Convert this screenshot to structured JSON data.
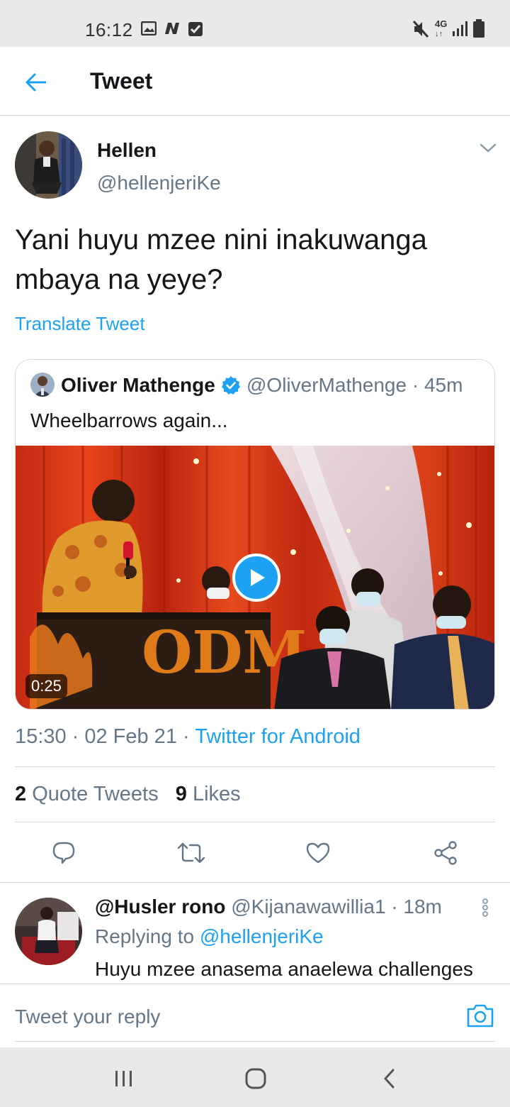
{
  "status_bar": {
    "time": "16:12",
    "network": "4G"
  },
  "header": {
    "title": "Tweet"
  },
  "tweet": {
    "author_name": "Hellen",
    "author_handle": "@hellenjeriKe",
    "text": "Yani huyu mzee nini inakuwanga mbaya na yeye?",
    "translate_label": "Translate Tweet",
    "timestamp": "15:30 · 02 Feb 21 · ",
    "source": "Twitter for Android",
    "quote_count": "2",
    "quote_label": " Quote Tweets",
    "like_count": "9",
    "like_label": " Likes"
  },
  "quoted": {
    "name": "Oliver Mathenge",
    "meta": "@OliverMathenge · 45m",
    "text": "Wheelbarrows again...",
    "video_duration": "0:25",
    "podium_text": "ODM"
  },
  "reply": {
    "name": "@Husler rono",
    "meta": " @Kijanawawillia1 · 18m",
    "replying_prefix": "Replying to ",
    "replying_handle": "@hellenjeriKe",
    "text": "Huyu mzee anasema anaelewa challenges"
  },
  "compose": {
    "placeholder": "Tweet your reply"
  },
  "colors": {
    "accent": "#1da1f2",
    "muted": "#657786",
    "text": "#14171a"
  }
}
